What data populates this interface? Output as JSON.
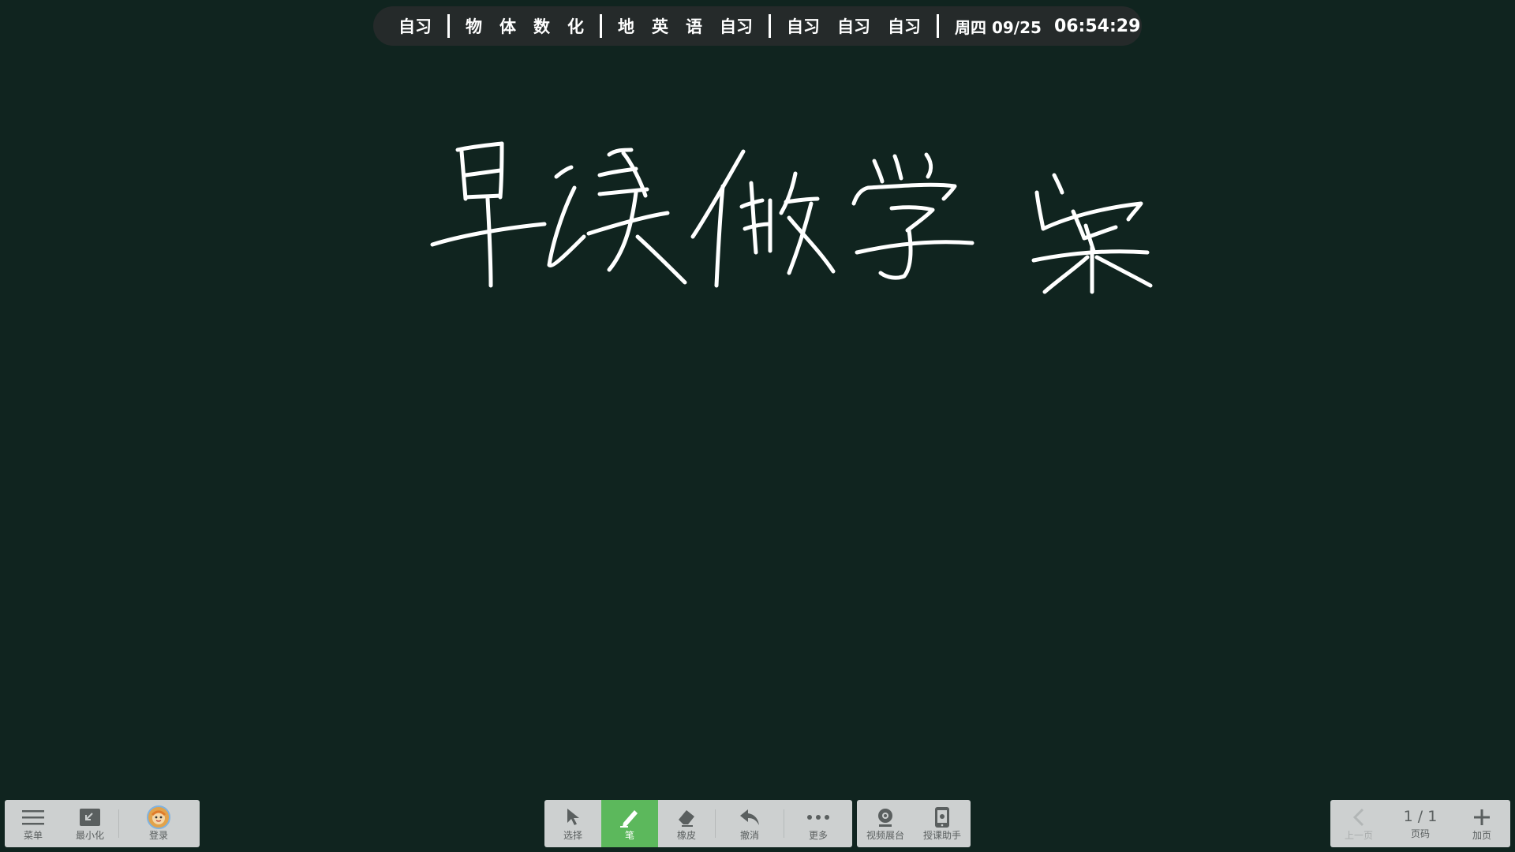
{
  "schedule": {
    "group1": [
      "自习"
    ],
    "group2": [
      "物",
      "体",
      "数",
      "化"
    ],
    "group3": [
      "地",
      "英",
      "语",
      "自习"
    ],
    "group4": [
      "自习",
      "自习",
      "自习"
    ],
    "date": "周四 09/25",
    "time": "06:54:29"
  },
  "toolbar_left": {
    "menu": "菜单",
    "minimize": "最小化",
    "login": "登录"
  },
  "toolbar_center": {
    "select": "选择",
    "pen": "笔",
    "eraser": "橡皮",
    "undo": "撤消",
    "more": "更多",
    "video": "视频展台",
    "assistant": "授课助手"
  },
  "toolbar_right": {
    "prev": "上一页",
    "page": "1 / 1",
    "page_label": "页码",
    "add": "加页"
  },
  "colors": {
    "board": "#10241f",
    "ink": "#ffffff",
    "active_tool": "#5cb85c"
  },
  "icons": [
    "menu-icon",
    "minimize-icon",
    "avatar-icon",
    "cursor-icon",
    "pen-icon",
    "eraser-icon",
    "undo-icon",
    "more-icon",
    "webcam-icon",
    "phone-icon",
    "chevron-left-icon",
    "plus-icon"
  ]
}
